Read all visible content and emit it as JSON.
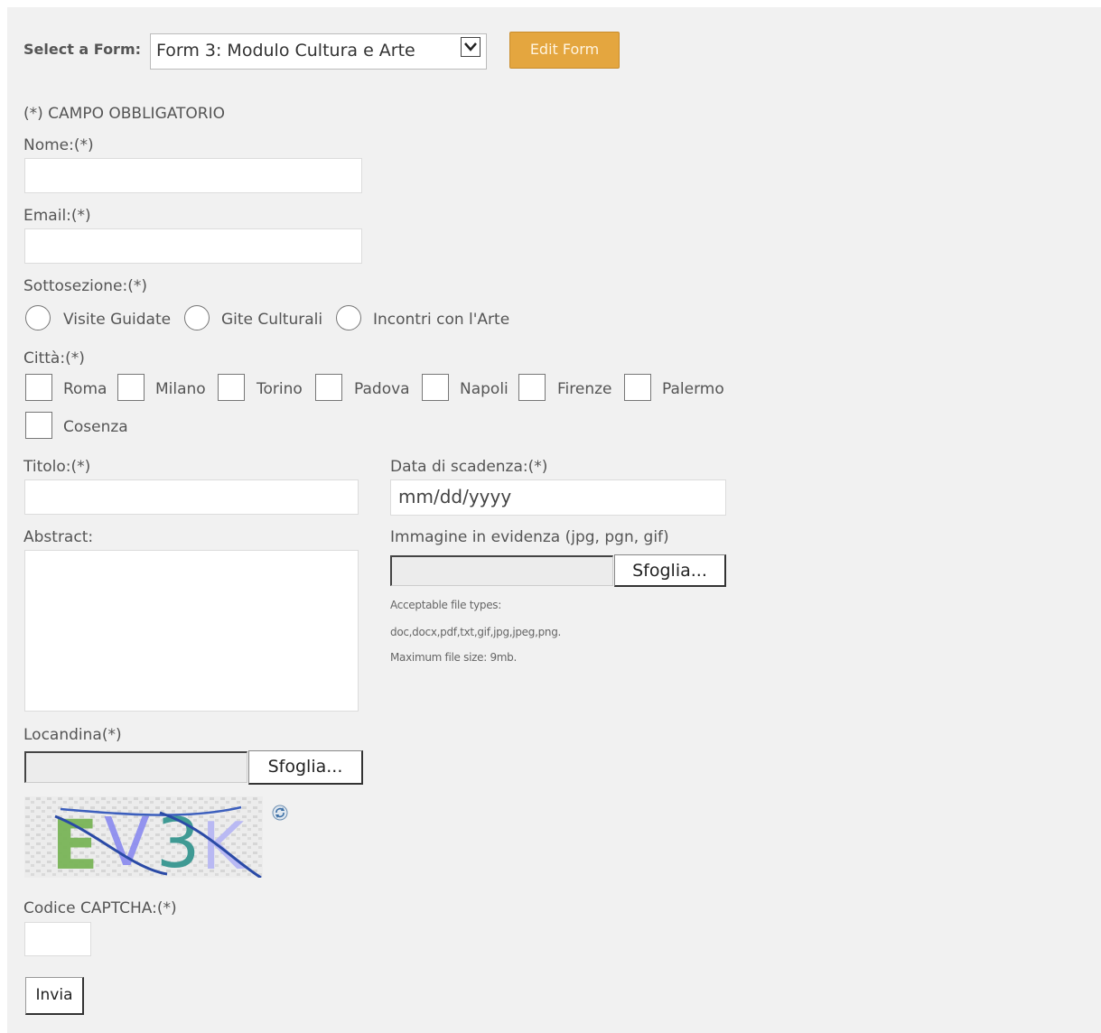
{
  "form_selector": {
    "label": "Select a Form:",
    "selected": "Form 3: Modulo Cultura e Arte",
    "edit_button": "Edit Form"
  },
  "required_note": "(*) CAMPO OBBLIGATORIO",
  "fields": {
    "nome_label": "Nome:(*)",
    "email_label": "Email:(*)",
    "sottosezione_label": "Sottosezione:(*)",
    "sottosezione_options": [
      "Visite Guidate",
      "Gite Culturali",
      "Incontri con l'Arte"
    ],
    "citta_label": "Città:(*)",
    "citta_options": [
      "Roma",
      "Milano",
      "Torino",
      "Padova",
      "Napoli",
      "Firenze",
      "Palermo",
      "Cosenza"
    ],
    "titolo_label": "Titolo:(*)",
    "data_label": "Data di scadenza:(*)",
    "data_placeholder": "mm/dd/yyyy",
    "abstract_label": "Abstract:",
    "immagine_label": "Immagine in evidenza (jpg, pgn, gif)",
    "browse_label": "Sfoglia...",
    "file_types_line1": "Acceptable file types:",
    "file_types_line2": "doc,docx,pdf,txt,gif,jpg,jpeg,png.",
    "max_size": "Maximum file size: 9mb.",
    "locandina_label": "Locandina(*)",
    "captcha_text": "EV3K",
    "captcha_label": "Codice CAPTCHA:(*)",
    "submit_label": "Invia"
  },
  "icons": {
    "captcha_refresh": "refresh-icon",
    "select_arrow": "chevron-down-icon"
  },
  "colors": {
    "panel_bg": "#f1f1f1",
    "edit_button_bg": "#e4a63f"
  }
}
